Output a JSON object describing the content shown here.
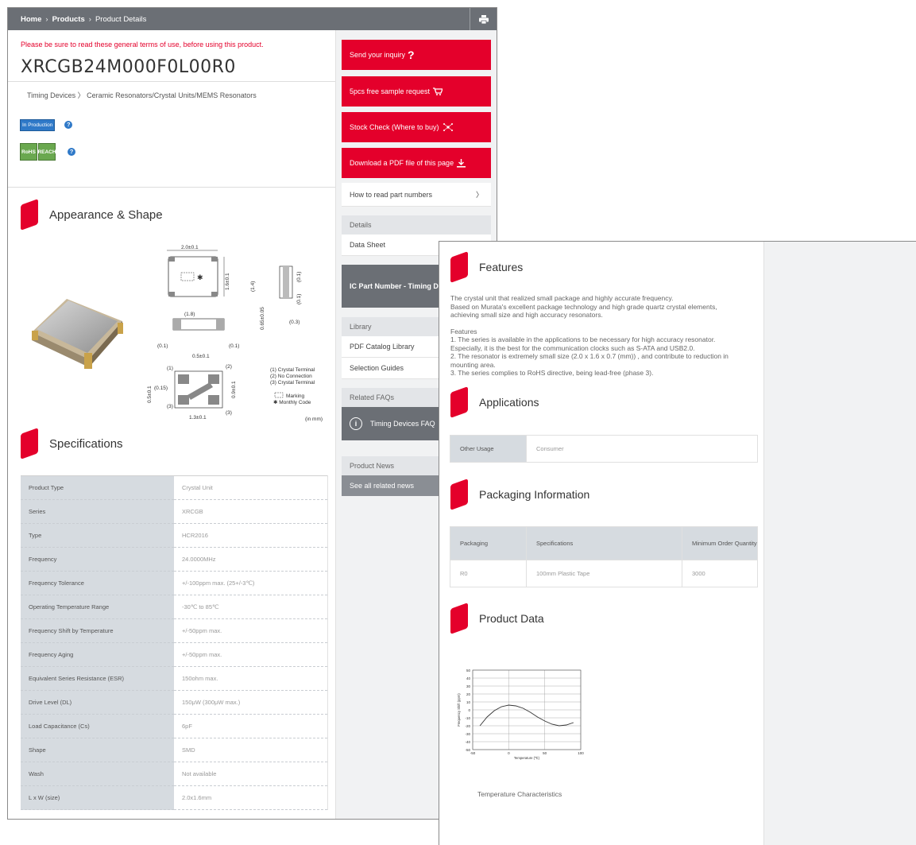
{
  "breadcrumb": {
    "home": "Home",
    "products": "Products",
    "current": "Product Details"
  },
  "terms_notice": "Please be sure to read these general terms of use, before using this product.",
  "part_number": "XRCGB24M000F0L00R0",
  "category": "Timing Devices 〉 Ceramic Resonators/Crystal Units/MEMS Resonators",
  "badges": {
    "status": "In Production",
    "rohs": "RoHS",
    "reach": "REACH",
    "help": "?"
  },
  "sections": {
    "appearance": "Appearance & Shape",
    "specifications": "Specifications",
    "features": "Features",
    "applications": "Applications",
    "packaging": "Packaging Information",
    "product_data": "Product Data"
  },
  "drawing": {
    "dim_w": "2.0±0.1",
    "dim_h": "1.6±0.1",
    "dim_14": "(1.4)",
    "dim_18": "(1.8)",
    "dim_01a": "(0.1)",
    "dim_01b": "(0.1)",
    "dim_01c": "(0.1)",
    "dim_01d": "(0.1)",
    "dim_065": "0.65±0.05",
    "dim_03": "(0.3)",
    "dim_05": "0.5±0.1",
    "dim_05v": "0.5±0.1",
    "dim_015": "(0.15)",
    "dim_09": "0.9±0.1",
    "dim_13": "1.3±0.1",
    "pin1": "(1)",
    "pin2": "(2)",
    "pin3a": "(3)",
    "pin3b": "(3)",
    "legend1": "(1) Crystal Terminal",
    "legend2": "(2) No Connection",
    "legend3": "(3) Crystal Terminal",
    "marking": "Marking",
    "monthly": "✱  Monthly Code",
    "unit": "(in mm)"
  },
  "specs": [
    {
      "label": "Product Type",
      "value": "Crystal Unit"
    },
    {
      "label": "Series",
      "value": "XRCGB"
    },
    {
      "label": "Type",
      "value": "HCR2016"
    },
    {
      "label": "Frequency",
      "value": "24.0000MHz"
    },
    {
      "label": "Frequency Tolerance",
      "value": "+/-100ppm max. (25+/-3℃)"
    },
    {
      "label": "Operating Temperature Range",
      "value": "-30℃ to 85℃"
    },
    {
      "label": "Frequency Shift by Temperature",
      "value": "+/-50ppm max."
    },
    {
      "label": "Frequency Aging",
      "value": "+/-50ppm max."
    },
    {
      "label": "Equivalent Series Resistance (ESR)",
      "value": "150ohm max."
    },
    {
      "label": "Drive Level (DL)",
      "value": "150μW (300μW max.)"
    },
    {
      "label": "Load Capacitance (Cs)",
      "value": "6pF"
    },
    {
      "label": "Shape",
      "value": "SMD"
    },
    {
      "label": "Wash",
      "value": "Not available"
    },
    {
      "label": "L x W (size)",
      "value": "2.0x1.6mm"
    }
  ],
  "sidebar": {
    "inquiry": "Send your inquiry",
    "sample": "5pcs free sample request",
    "stock": "Stock Check (Where to buy)",
    "pdf": "Download a PDF file of this page",
    "read_part": "How to read part numbers",
    "chevron": "〉",
    "details_head": "Details",
    "datasheet": "Data Sheet",
    "ic_search": "IC Part Number - Timing Devices Search",
    "library_head": "Library",
    "pdf_catalog": "PDF Catalog Library",
    "selection": "Selection Guides",
    "faq_head": "Related FAQs",
    "faq_link": "Timing Devices FAQ",
    "news_head": "Product News",
    "news_link": "See all related news"
  },
  "features_text": {
    "l1": "The crystal unit that realized small package and highly accurate frequency.",
    "l2": "Based on Murata's excellent package technology and high grade quartz crystal elements,",
    "l3": "achieving small size and high accuracy resonators.",
    "l4": "Features",
    "l5": "1. The series is available in the applications to be necessary for high accuracy resonator.",
    "l6": "Especially, it is the best for the communication clocks such as S-ATA and USB2.0.",
    "l7": "2. The resonator is extremely small size (2.0 x 1.6 x 0.7 (mm)) , and contribute to reduction in",
    "l8": "mounting area.",
    "l9": "3. The series complies to RoHS directive, being lead-free (phase 3)."
  },
  "applications": {
    "label": "Other Usage",
    "value": "Consumer"
  },
  "packaging": {
    "headers": [
      "Packaging",
      "Specifications",
      "Minimum Order Quantity"
    ],
    "row": [
      "R0",
      "100mm Plastic Tape",
      "3000"
    ]
  },
  "chart_caption": "Temperature Characteristics",
  "chart_data": {
    "type": "line",
    "title": "",
    "xlabel": "Temperature (℃)",
    "ylabel": "Frequency Shift (ppm)",
    "xlim": [
      -50,
      100
    ],
    "ylim": [
      -50,
      50
    ],
    "xticks": [
      -50,
      0,
      50,
      100
    ],
    "yticks": [
      50,
      40,
      30,
      20,
      10,
      0,
      -10,
      -20,
      -30,
      -40,
      -50
    ],
    "x": [
      -40,
      -30,
      -20,
      -10,
      0,
      10,
      20,
      30,
      40,
      50,
      60,
      70,
      80,
      90
    ],
    "y": [
      -20,
      -9,
      -1,
      4,
      6,
      5,
      2,
      -3,
      -9,
      -14,
      -18,
      -20,
      -19,
      -16
    ]
  },
  "colors": {
    "accent": "#e4002b",
    "bar": "#6b6f75",
    "label_cell": "#d6dbe0"
  }
}
